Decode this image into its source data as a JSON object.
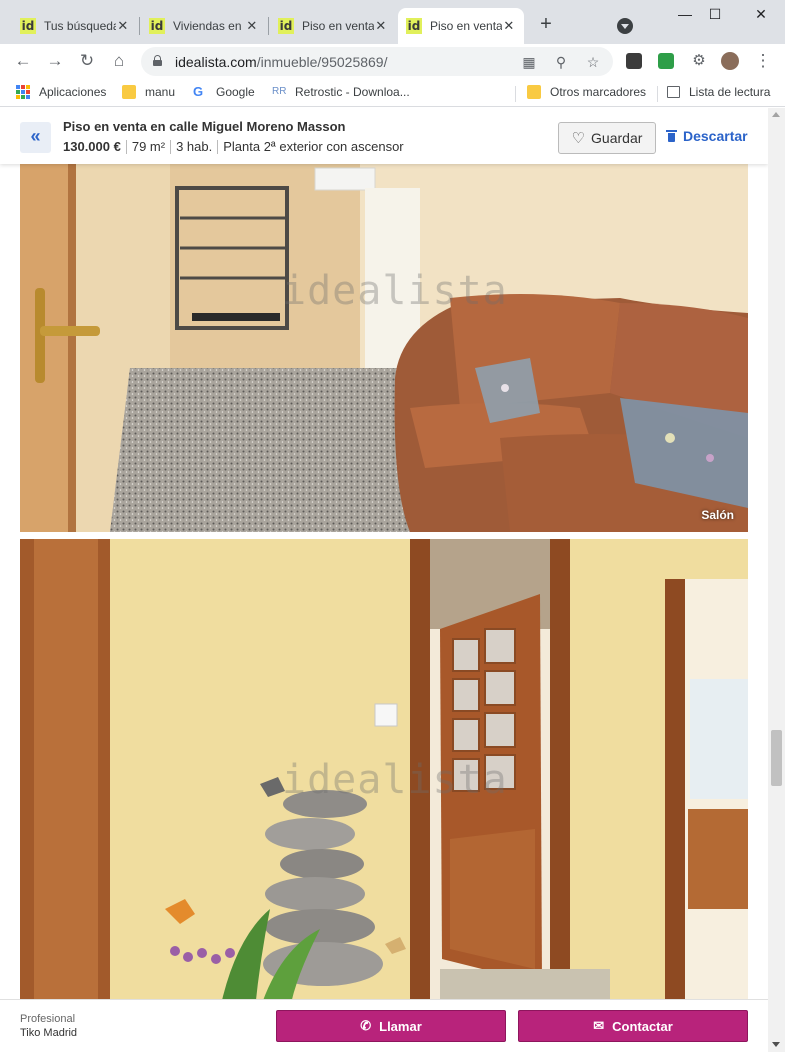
{
  "browser": {
    "tabs": [
      {
        "label": "Tus búsquedas guardadas",
        "favicon": "id",
        "active": false
      },
      {
        "label": "Viviendas en venta",
        "favicon": "id",
        "active": false
      },
      {
        "label": "Piso en venta en calle",
        "favicon": "id",
        "active": false
      },
      {
        "label": "Piso en venta en calle",
        "favicon": "id",
        "active": true
      }
    ],
    "tab_close_glyph": "✕",
    "new_tab_glyph": "+",
    "window_controls": {
      "minimize": "—",
      "maximize": "☐",
      "close": "✕"
    },
    "address": {
      "host": "idealista.com",
      "path": "/inmueble/95025869/"
    },
    "bookmarks": [
      {
        "label": "Aplicaciones",
        "icon": "apps-grid-icon"
      },
      {
        "label": "manu",
        "icon": "folder-icon"
      },
      {
        "label": "Google",
        "icon": "google-icon"
      },
      {
        "label": "Retrostic - Downloa...",
        "icon": "retrostic-icon"
      }
    ],
    "bookmarks_right": [
      {
        "label": "Otros marcadores",
        "icon": "folder-icon"
      },
      {
        "label": "Lista de lectura",
        "icon": "reading-list-icon"
      }
    ]
  },
  "listing": {
    "back_glyph": "«",
    "title": "Piso en venta en calle Miguel Moreno Masson",
    "price": "130.000 €",
    "size": "79 m²",
    "rooms": "3 hab.",
    "floor": "Planta 2ª exterior con ascensor",
    "save_label": "Guardar",
    "discard_label": "Descartar",
    "watermark": "idealista",
    "photos": [
      {
        "caption": "Salón"
      },
      {
        "caption": ""
      }
    ]
  },
  "contact": {
    "type": "Profesional",
    "name": "Tiko Madrid",
    "call_label": "Llamar",
    "contact_label": "Contactar"
  },
  "colors": {
    "brand_magenta": "#b8237b",
    "link_blue": "#2b63c9",
    "favicon_yellow": "#e1f05b"
  }
}
